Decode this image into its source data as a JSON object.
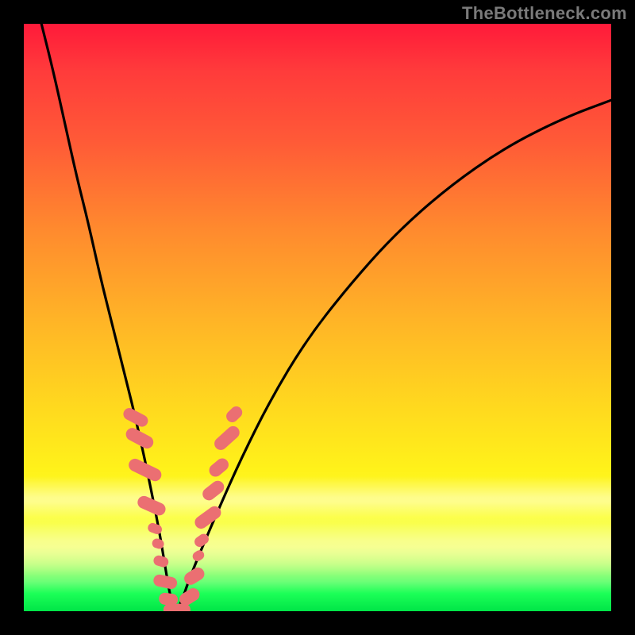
{
  "watermark": "TheBottleneck.com",
  "colors": {
    "frame": "#000000",
    "curve": "#000000",
    "marker": "#eb6f72",
    "gradient_stops": [
      "#ff1a3a",
      "#ff5a37",
      "#ffb327",
      "#fff21a",
      "#6bff77",
      "#00e547"
    ]
  },
  "chart_data": {
    "type": "line",
    "title": "",
    "xlabel": "",
    "ylabel": "",
    "xlim": [
      0,
      100
    ],
    "ylim": [
      0,
      100
    ],
    "description": "V-shaped bottleneck curve: value falls to ~0 around x≈25 then rises again. Background gradient red (top) → green (bottom). Pink rounded markers cluster along the curve near the trough.",
    "series": [
      {
        "name": "bottleneck-curve",
        "x": [
          3,
          5,
          7,
          9,
          11,
          13,
          15,
          17,
          19,
          21,
          23,
          24,
          25,
          26,
          27,
          28,
          30,
          33,
          37,
          42,
          48,
          55,
          63,
          72,
          82,
          92,
          100
        ],
        "y": [
          100,
          92,
          83,
          74,
          66,
          57,
          49,
          41,
          33,
          24,
          14,
          8,
          2,
          0,
          2,
          5,
          10,
          17,
          26,
          36,
          46,
          55,
          64,
          72,
          79,
          84,
          87
        ]
      }
    ],
    "markers": [
      {
        "x": 19.0,
        "y": 33.0,
        "w": 2.0,
        "h": 4.5,
        "rot": -62
      },
      {
        "x": 19.7,
        "y": 29.5,
        "w": 2.2,
        "h": 5.0,
        "rot": -62
      },
      {
        "x": 20.7,
        "y": 24.0,
        "w": 2.2,
        "h": 6.0,
        "rot": -64
      },
      {
        "x": 21.7,
        "y": 18.0,
        "w": 2.2,
        "h": 5.0,
        "rot": -66
      },
      {
        "x": 22.3,
        "y": 14.0,
        "w": 1.6,
        "h": 2.4,
        "rot": -70
      },
      {
        "x": 22.9,
        "y": 11.5,
        "w": 1.6,
        "h": 2.0,
        "rot": -72
      },
      {
        "x": 23.4,
        "y": 8.5,
        "w": 1.8,
        "h": 2.6,
        "rot": -74
      },
      {
        "x": 24.0,
        "y": 5.0,
        "w": 2.0,
        "h": 4.0,
        "rot": -78
      },
      {
        "x": 24.6,
        "y": 2.0,
        "w": 2.0,
        "h": 3.2,
        "rot": -82
      },
      {
        "x": 25.3,
        "y": 0.3,
        "w": 3.0,
        "h": 2.0,
        "rot": 0
      },
      {
        "x": 26.8,
        "y": 0.3,
        "w": 3.0,
        "h": 2.0,
        "rot": 0
      },
      {
        "x": 28.2,
        "y": 2.5,
        "w": 2.2,
        "h": 3.6,
        "rot": 58
      },
      {
        "x": 29.0,
        "y": 6.0,
        "w": 2.2,
        "h": 3.6,
        "rot": 58
      },
      {
        "x": 29.7,
        "y": 9.5,
        "w": 1.6,
        "h": 2.0,
        "rot": 56
      },
      {
        "x": 30.3,
        "y": 12.0,
        "w": 1.8,
        "h": 2.6,
        "rot": 55
      },
      {
        "x": 31.3,
        "y": 16.0,
        "w": 2.2,
        "h": 5.0,
        "rot": 54
      },
      {
        "x": 32.3,
        "y": 20.5,
        "w": 2.2,
        "h": 4.0,
        "rot": 52
      },
      {
        "x": 33.3,
        "y": 24.5,
        "w": 2.2,
        "h": 3.6,
        "rot": 50
      },
      {
        "x": 34.6,
        "y": 29.5,
        "w": 2.2,
        "h": 5.0,
        "rot": 48
      },
      {
        "x": 35.8,
        "y": 33.5,
        "w": 2.0,
        "h": 3.0,
        "rot": 46
      }
    ]
  }
}
